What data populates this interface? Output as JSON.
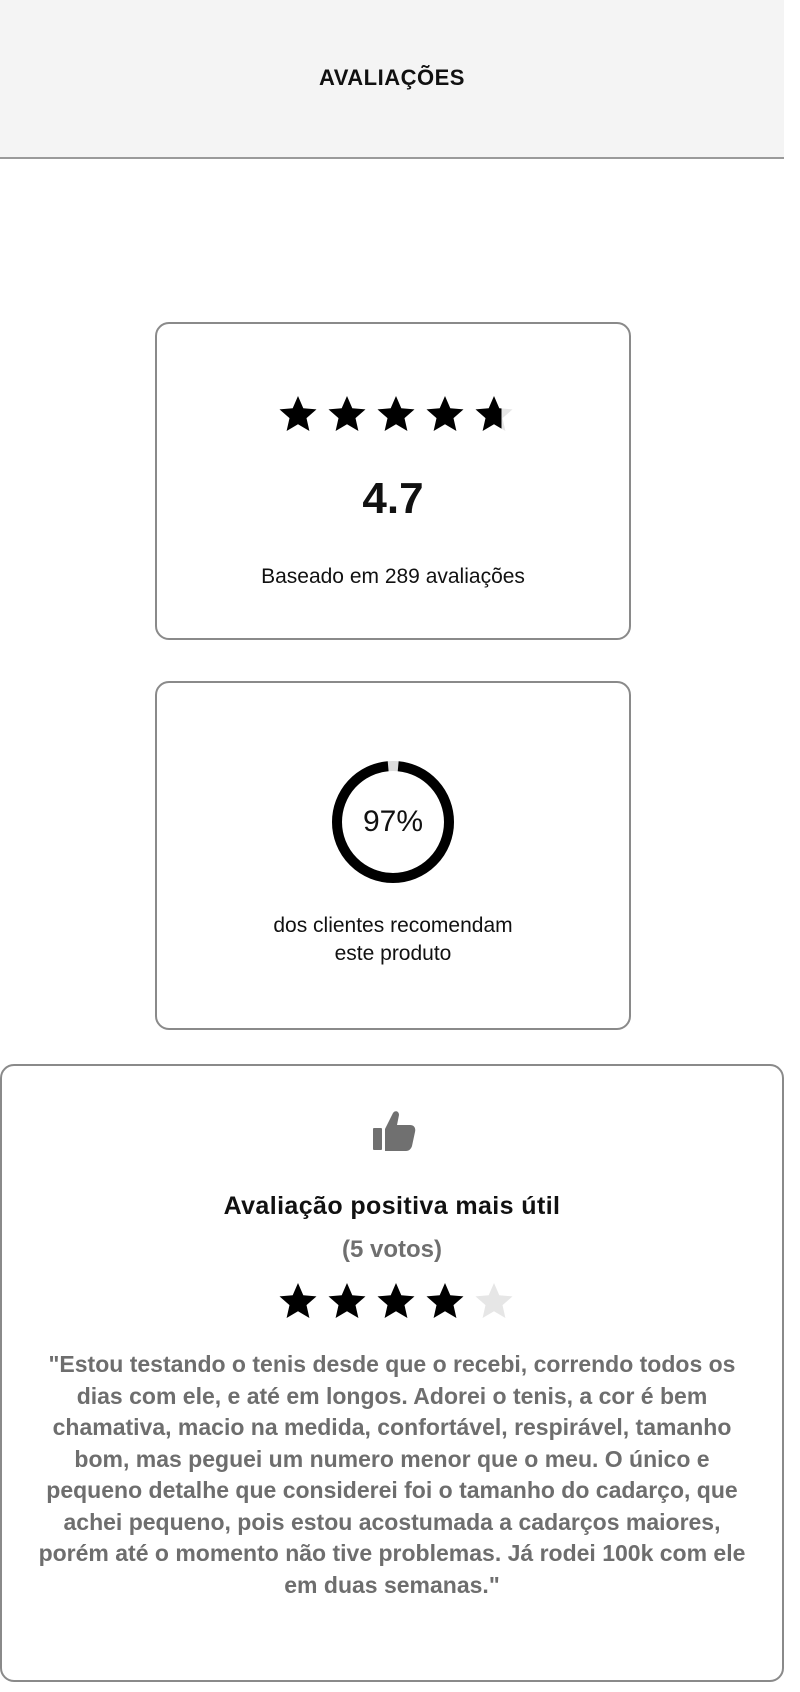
{
  "header": {
    "title": "AVALIAÇÕES"
  },
  "rating_summary": {
    "value": "4.7",
    "value_numeric": 4.7,
    "stars_filled": 4.7,
    "stars_total": 5,
    "caption": "Baseado em 289 avaliações"
  },
  "recommendation": {
    "percent_label": "97%",
    "percent": 97,
    "text_line1": "dos clientes recomendam",
    "text_line2": "este produto"
  },
  "top_review": {
    "icon": "thumbs-up-icon",
    "title": "Avaliação positiva mais útil",
    "votes": "(5 votos)",
    "stars_filled": 4,
    "stars_total": 5,
    "text": "\"Estou testando o tenis desde que o recebi, correndo todos os dias com ele, e até em longos. Adorei o tenis, a cor é bem chamativa, macio na medida, confortável, respirável, tamanho bom, mas peguei um numero menor que o meu. O único e pequeno detalhe que considerei foi o tamanho do cadarço, que achei pequeno, pois estou acostumada a cadarços maiores, porém até o momento não tive problemas. Já rodei 100k com ele em duas semanas.\""
  },
  "colors": {
    "star_filled": "#000000",
    "star_empty": "#e6e6e6",
    "ring_fill": "#000000",
    "ring_track": "#dddddd",
    "review_text": "#6e6e6e",
    "header_bg": "#f4f4f4",
    "thumb_icon": "#707070"
  }
}
